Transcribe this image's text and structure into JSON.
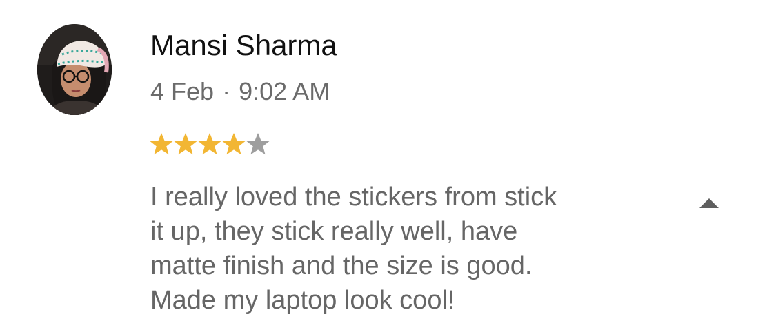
{
  "reviewer": {
    "name": "Mansi Sharma",
    "avatar_icon": "user-photo-avatar"
  },
  "meta": {
    "date": "4 Feb",
    "separator": "·",
    "time": "9:02 AM"
  },
  "rating": {
    "value": 4,
    "max": 5,
    "filled_color": "#F2B633",
    "empty_color": "#9E9E9E"
  },
  "review": {
    "lines": [
      "I really loved the stickers from stick",
      "it up, they stick really well, have",
      "matte finish and the size is good.",
      "Made my laptop look cool!"
    ]
  },
  "controls": {
    "collapse_icon": "chevron-up-icon"
  }
}
